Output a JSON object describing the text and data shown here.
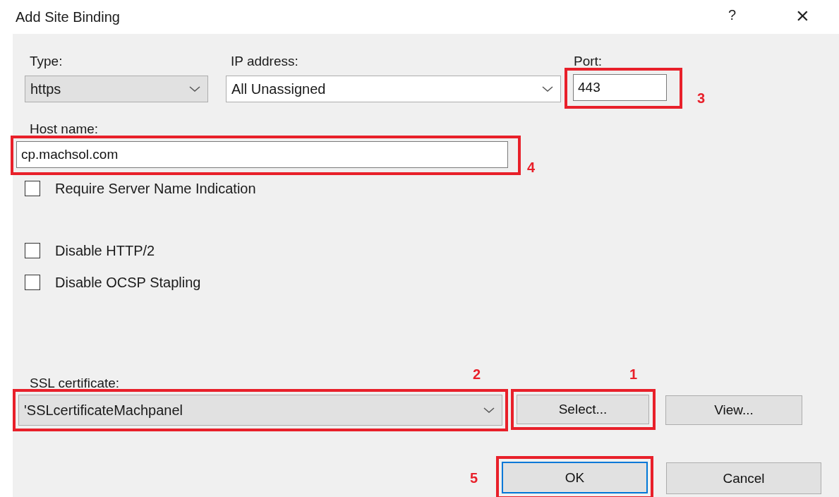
{
  "window": {
    "title": "Add Site Binding",
    "help": "?",
    "close": "×"
  },
  "type": {
    "label": "Type:",
    "value": "https"
  },
  "ip_address": {
    "label": "IP address:",
    "value": "All Unassigned"
  },
  "port": {
    "label": "Port:",
    "value": "443",
    "annotation": "3"
  },
  "host_name": {
    "label": "Host name:",
    "value": "cp.machsol.com",
    "annotation": "4"
  },
  "options": [
    {
      "label": "Require Server Name Indication",
      "checked": false
    },
    {
      "label": "Disable HTTP/2",
      "checked": false
    },
    {
      "label": "Disable OCSP Stapling",
      "checked": false
    }
  ],
  "ssl_certificate": {
    "label": "SSL certificate:",
    "value": "'SSLcertificateMachpanel",
    "annotation": "2"
  },
  "certificate_buttons": [
    {
      "label": "Select...",
      "annotation": "1"
    },
    {
      "label": "View..."
    }
  ],
  "dialog_buttons": [
    {
      "label": "OK",
      "default": true,
      "annotation": "5"
    },
    {
      "label": "Cancel",
      "default": false
    }
  ]
}
